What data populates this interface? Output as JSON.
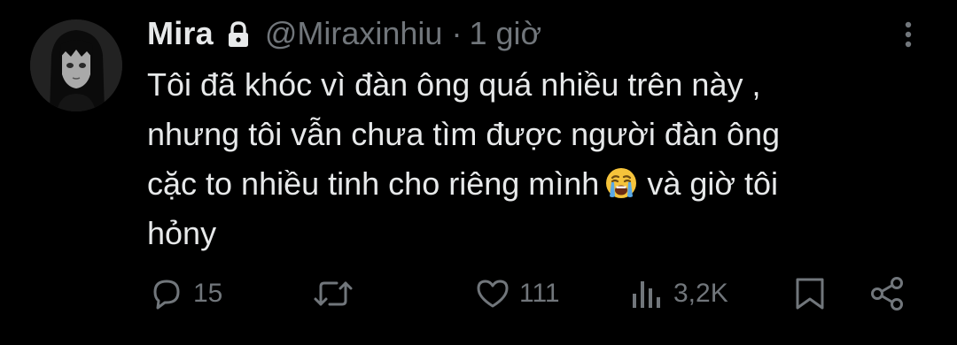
{
  "tweet": {
    "display_name": "Mira",
    "handle": "@Miraxinhiu",
    "separator": "·",
    "time": "1 giờ",
    "text_lines": [
      "Tôi đã khóc vì đàn ông quá nhiều trên này ,",
      "nhưng tôi vẫn chưa tìm được người đàn ông",
      "cặc to nhiều tinh cho riêng mình",
      "hỏny"
    ],
    "text_line3_after_emoji": "và giờ tôi",
    "emoji": "loudly-crying-face"
  },
  "actions": {
    "replies": "15",
    "retweets": "",
    "likes": "111",
    "views": "3,2K"
  },
  "icons": {
    "lock": "lock-icon",
    "more": "more-vertical-icon",
    "reply": "reply-icon",
    "retweet": "retweet-icon",
    "like": "heart-icon",
    "views": "views-chart-icon",
    "bookmark": "bookmark-icon",
    "share": "share-icon"
  },
  "colors": {
    "background": "#000000",
    "text": "#e7e9ea",
    "secondary": "#71767b"
  }
}
